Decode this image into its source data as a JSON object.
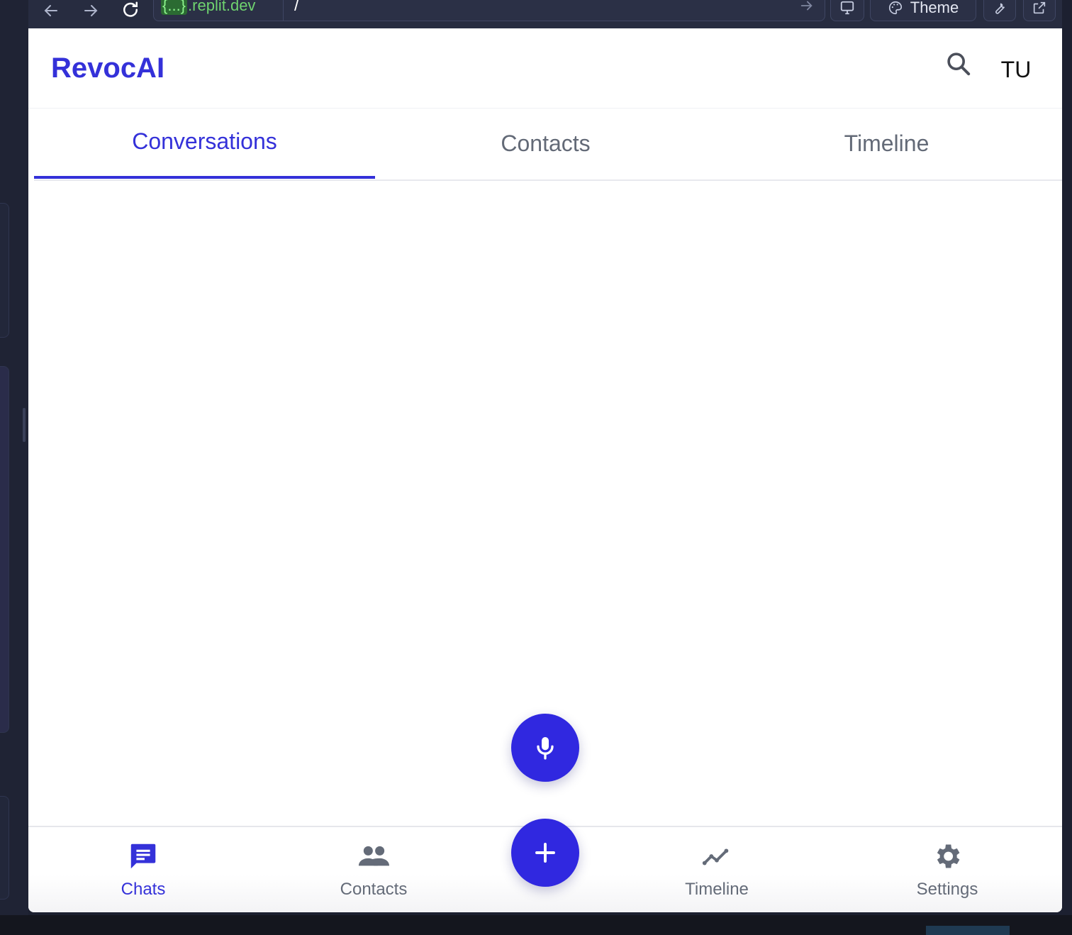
{
  "browser": {
    "url_chip": "{...}",
    "url_domain": ".replit.dev",
    "url_path": "/",
    "theme_label": "Theme"
  },
  "app": {
    "brand": "RevocAI",
    "avatar_initials": "TU"
  },
  "tabs": [
    {
      "label": "Conversations",
      "active": true
    },
    {
      "label": "Contacts",
      "active": false
    },
    {
      "label": "Timeline",
      "active": false
    }
  ],
  "bottom_nav": [
    {
      "label": "Chats",
      "icon": "chat-icon",
      "active": true
    },
    {
      "label": "Contacts",
      "icon": "people-icon",
      "active": false
    },
    {
      "label": "Timeline",
      "icon": "trend-icon",
      "active": false
    },
    {
      "label": "Settings",
      "icon": "gear-icon",
      "active": false
    }
  ],
  "fabs": [
    {
      "icon": "microphone-icon"
    },
    {
      "icon": "plus-icon"
    }
  ],
  "colors": {
    "brand": "#3431d9",
    "fab": "#3028e0",
    "inactive_text": "#636a77",
    "toolbar": "#272c40",
    "url_green": "#6fd36f"
  }
}
